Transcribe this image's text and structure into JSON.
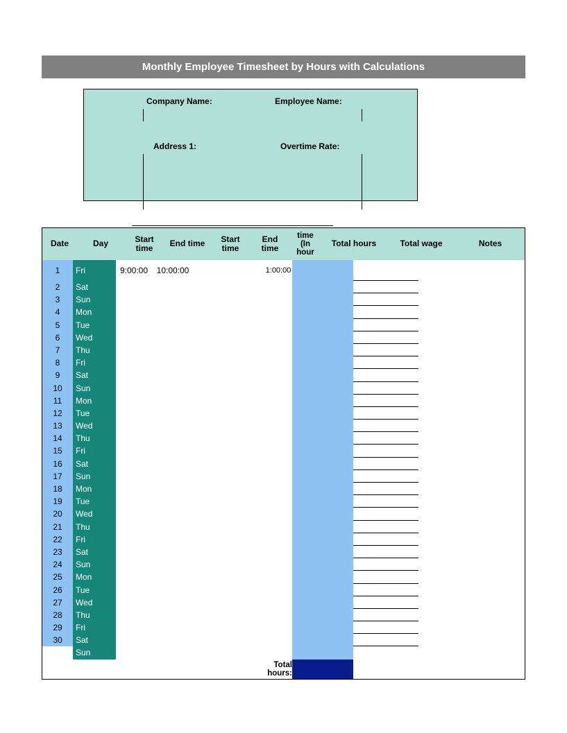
{
  "title": "Monthly Employee Timesheet by Hours with Calculations",
  "labels": {
    "company": "Company Name:",
    "address": "Address 1:",
    "employee": "Employee Name:",
    "overtime": "Overtime Rate:"
  },
  "columns": {
    "date": "Date",
    "day": "Day",
    "start1": "Start time",
    "end1": "End time",
    "start2": "Start time",
    "end2": "End time",
    "timein": "time (In hour",
    "thours": "Total hours",
    "twage": "Total wage",
    "notes": "Notes"
  },
  "rows": [
    {
      "date": "1",
      "day": "Fri",
      "s1": "9:00:00",
      "e1": "10:00:00",
      "ti": "1:00:00"
    },
    {
      "date": "2",
      "day": "Sat"
    },
    {
      "date": "3",
      "day": "Sun"
    },
    {
      "date": "4",
      "day": "Mon"
    },
    {
      "date": "5",
      "day": "Tue"
    },
    {
      "date": "6",
      "day": "Wed"
    },
    {
      "date": "7",
      "day": "Thu"
    },
    {
      "date": "8",
      "day": "Fri"
    },
    {
      "date": "9",
      "day": "Sat"
    },
    {
      "date": "10",
      "day": "Sun"
    },
    {
      "date": "11",
      "day": "Mon"
    },
    {
      "date": "12",
      "day": "Tue"
    },
    {
      "date": "13",
      "day": "Wed"
    },
    {
      "date": "14",
      "day": "Thu"
    },
    {
      "date": "15",
      "day": "Fri"
    },
    {
      "date": "16",
      "day": "Sat"
    },
    {
      "date": "17",
      "day": "Sun"
    },
    {
      "date": "18",
      "day": "Mon"
    },
    {
      "date": "19",
      "day": "Tue"
    },
    {
      "date": "20",
      "day": "Wed"
    },
    {
      "date": "21",
      "day": "Thu"
    },
    {
      "date": "22",
      "day": "Fri"
    },
    {
      "date": "23",
      "day": "Sat"
    },
    {
      "date": "24",
      "day": "Sun"
    },
    {
      "date": "25",
      "day": "Mon"
    },
    {
      "date": "26",
      "day": "Tue"
    },
    {
      "date": "27",
      "day": "Wed"
    },
    {
      "date": "28",
      "day": "Thu"
    },
    {
      "date": "29",
      "day": "Fri"
    },
    {
      "date": "30",
      "day": "Sat"
    },
    {
      "date": "",
      "day": "Sun"
    }
  ],
  "total_label": "Total hours:"
}
